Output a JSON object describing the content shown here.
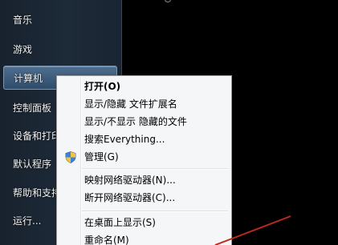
{
  "start_menu": {
    "items": [
      {
        "label": "音乐",
        "highlight": false
      },
      {
        "label": "游戏",
        "highlight": false
      },
      {
        "label": "计算机",
        "highlight": true
      },
      {
        "label": "控制面板",
        "highlight": false
      },
      {
        "label": "设备和打印机",
        "highlight": false
      },
      {
        "label": "默认程序",
        "highlight": false
      },
      {
        "label": "帮助和支持",
        "highlight": false
      },
      {
        "label": "运行...",
        "highlight": false
      }
    ]
  },
  "context_menu": {
    "items": [
      {
        "label": "打开(O)",
        "bold": true
      },
      {
        "label": "显示/隐藏 文件扩展名"
      },
      {
        "label": "显示/不显示 隐藏的文件"
      },
      {
        "label": "搜索Everything..."
      },
      {
        "label": "管理(G)",
        "icon": "uac-shield-icon"
      },
      {
        "label": "映射网络驱动器(N)..."
      },
      {
        "label": "断开网络驱动器(C)..."
      },
      {
        "label": "在桌面上显示(S)"
      },
      {
        "label": "重命名(M)"
      }
    ]
  },
  "colors": {
    "menu_background": "#f5f6f7",
    "start_panel": "#1d2a38",
    "highlight": "#3f5f80",
    "annotation_line": "#c0281e"
  }
}
